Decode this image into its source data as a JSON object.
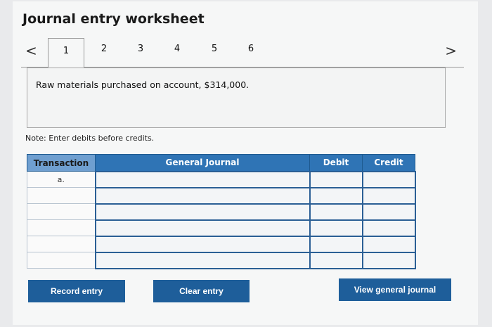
{
  "title": "Journal entry worksheet",
  "tabs": [
    "1",
    "2",
    "3",
    "4",
    "5",
    "6"
  ],
  "nav": {
    "prev": "<",
    "next": ">"
  },
  "description": "Raw materials purchased on account, $314,000.",
  "note": "Note: Enter debits before credits.",
  "table": {
    "headers": {
      "transaction": "Transaction",
      "general_journal": "General Journal",
      "debit": "Debit",
      "credit": "Credit"
    },
    "rows": [
      {
        "transaction": "a.",
        "account": "",
        "debit": "",
        "credit": ""
      },
      {
        "transaction": "",
        "account": "",
        "debit": "",
        "credit": ""
      },
      {
        "transaction": "",
        "account": "",
        "debit": "",
        "credit": ""
      },
      {
        "transaction": "",
        "account": "",
        "debit": "",
        "credit": ""
      },
      {
        "transaction": "",
        "account": "",
        "debit": "",
        "credit": ""
      },
      {
        "transaction": "",
        "account": "",
        "debit": "",
        "credit": ""
      }
    ]
  },
  "buttons": {
    "record": "Record entry",
    "clear": "Clear entry",
    "view": "View general journal"
  },
  "colors": {
    "button_bg": "#1e5e9a",
    "header_bg": "#2f74b5"
  }
}
